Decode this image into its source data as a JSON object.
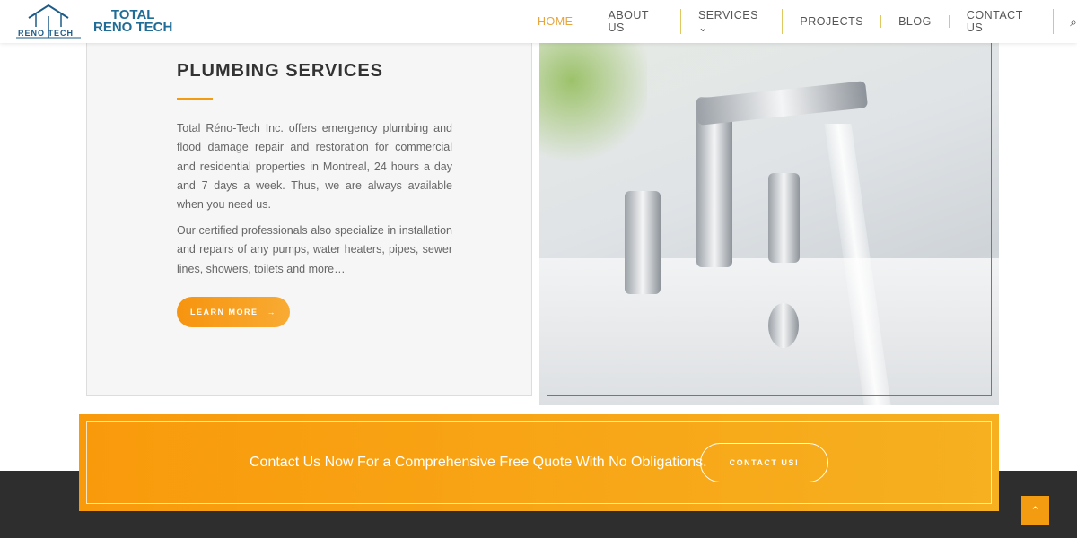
{
  "header": {
    "logo_small": "RENO TECH",
    "logo_line1": "TOTAL",
    "logo_line2": "RENO TECH",
    "nav": [
      {
        "label": "HOME",
        "active": true
      },
      {
        "label": "ABOUT US"
      },
      {
        "label": "SERVICES ⌄"
      },
      {
        "label": "PROJECTS"
      },
      {
        "label": "BLOG"
      },
      {
        "label": "CONTACT US"
      }
    ],
    "search_icon": "⌕"
  },
  "section": {
    "title": "PLUMBING SERVICES",
    "p1": "Total Réno-Tech Inc. offers emergency plumbing and flood damage repair and restoration for commercial and residential properties in Montreal, 24 hours a day and 7 days a week. Thus, we are always available when you need us.",
    "p2": "Our certified professionals also specialize in installation and repairs of any pumps, water heaters, pipes, sewer lines, showers, toilets and more…",
    "button": "LEARN MORE",
    "button_arrow": "→"
  },
  "banner": {
    "text": "Contact Us Now For a Comprehensive Free Quote With No Obligations.",
    "button": "CONTACT US!"
  },
  "scroll_top": "⌃",
  "colors": {
    "accent": "#f39c12",
    "logo": "#1f6d96"
  }
}
